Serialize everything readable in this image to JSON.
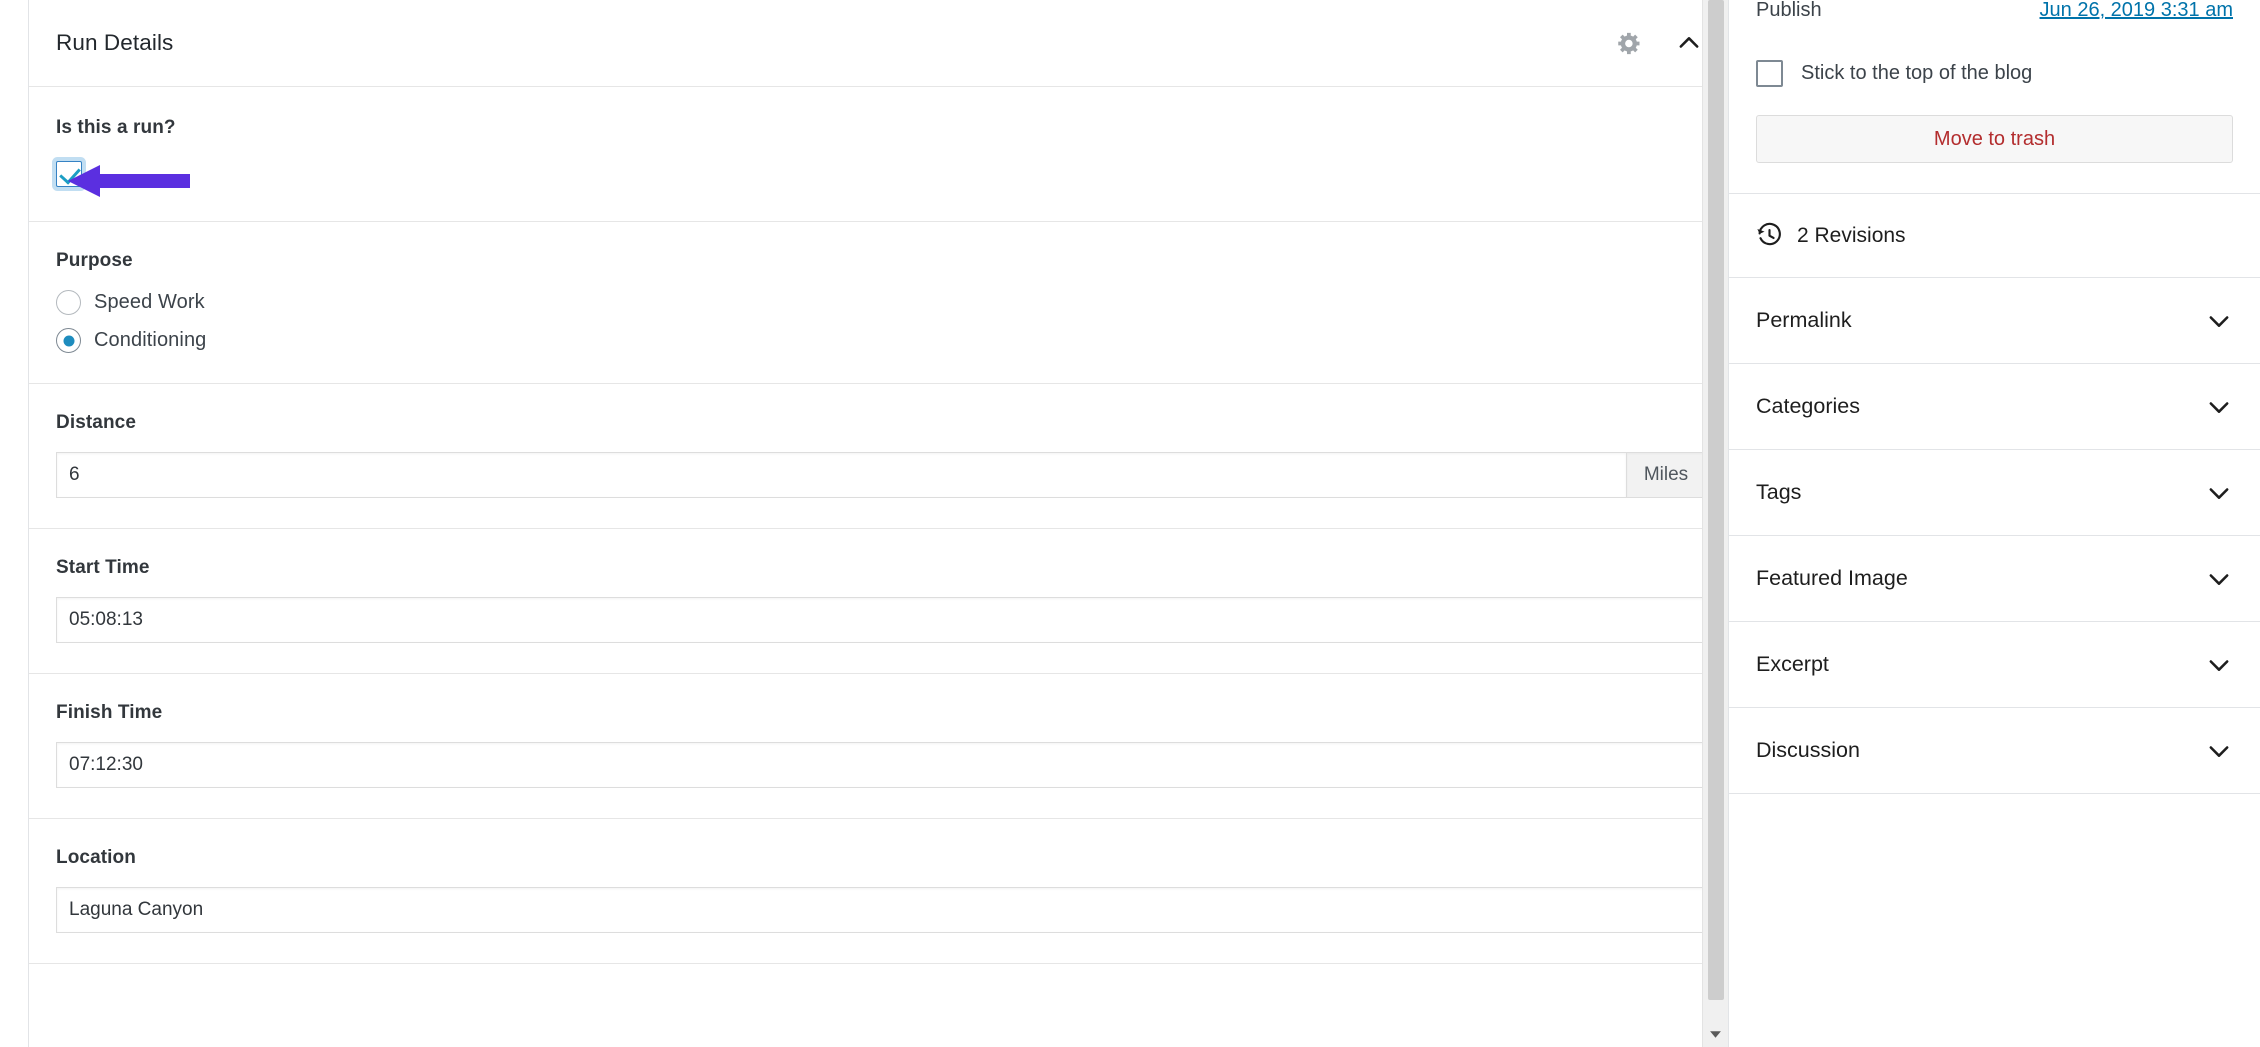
{
  "metabox": {
    "title": "Run Details",
    "icons": {
      "settings": "gear-icon",
      "collapse": "chevron-up-icon"
    },
    "fields": {
      "is_run": {
        "label": "Is this a run?",
        "checked": true,
        "annotation": "purple-arrow-pointing-at-checkbox"
      },
      "purpose": {
        "label": "Purpose",
        "options": [
          {
            "label": "Speed Work",
            "selected": false
          },
          {
            "label": "Conditioning",
            "selected": true
          }
        ]
      },
      "distance": {
        "label": "Distance",
        "value": "6",
        "placeholder": "",
        "unit": "Miles"
      },
      "start_time": {
        "label": "Start Time",
        "value": "05:08:13",
        "placeholder": ""
      },
      "finish_time": {
        "label": "Finish Time",
        "value": "07:12:30",
        "placeholder": ""
      },
      "location": {
        "label": "Location",
        "value": "Laguna Canyon",
        "placeholder": ""
      }
    }
  },
  "sidebar": {
    "publish": {
      "label": "Publish",
      "date": "Jun 26, 2019 3:31 am"
    },
    "sticky": {
      "label": "Stick to the top of the blog",
      "checked": false
    },
    "trash": {
      "label": "Move to trash"
    },
    "revisions": {
      "label": "2 Revisions",
      "icon": "history-icon"
    },
    "panels": [
      {
        "label": "Permalink",
        "icon": "chevron-down-icon"
      },
      {
        "label": "Categories",
        "icon": "chevron-down-icon"
      },
      {
        "label": "Tags",
        "icon": "chevron-down-icon"
      },
      {
        "label": "Featured Image",
        "icon": "chevron-down-icon"
      },
      {
        "label": "Excerpt",
        "icon": "chevron-down-icon"
      },
      {
        "label": "Discussion",
        "icon": "chevron-down-icon"
      }
    ]
  },
  "colors": {
    "link": "#0073aa",
    "danger": "#b32d2e",
    "accent": "#1e8cbe",
    "check": "#1c9ec4",
    "annotation": "#5b2fe0"
  }
}
